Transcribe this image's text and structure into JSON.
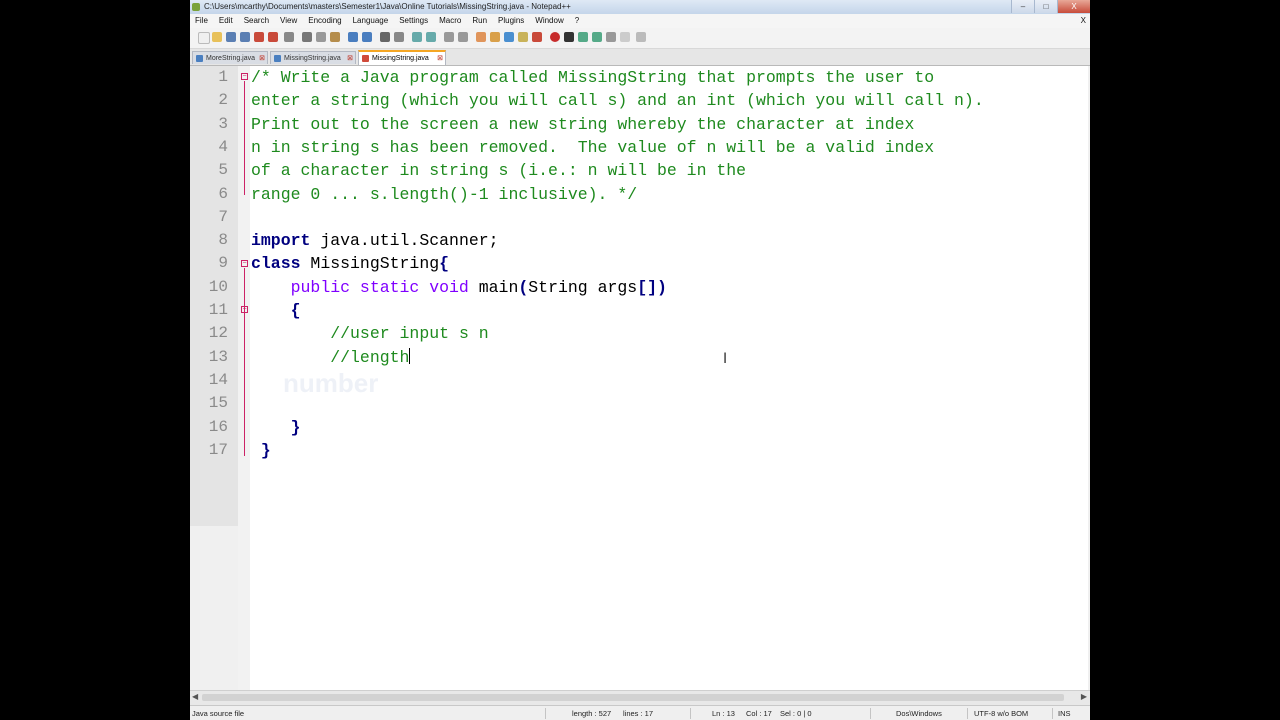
{
  "window": {
    "title": "C:\\Users\\mcarthy\\Documents\\masters\\Semester1\\Java\\Online Tutorials\\MissingString.java - Notepad++",
    "buttons": [
      "–",
      "□",
      "X"
    ]
  },
  "menu": {
    "items": [
      "File",
      "Edit",
      "Search",
      "View",
      "Encoding",
      "Language",
      "Settings",
      "Macro",
      "Run",
      "Plugins",
      "Window",
      "?"
    ],
    "close": "X"
  },
  "tabs": [
    {
      "label": "MoreString.java",
      "active": false
    },
    {
      "label": "MissingString.java",
      "active": false
    },
    {
      "label": "MissingString.java",
      "active": true
    }
  ],
  "editor": {
    "lines": [
      {
        "num": "1",
        "segments": [
          {
            "c": "cmt",
            "t": "/* Write a Java program called MissingString that prompts the user to"
          }
        ]
      },
      {
        "num": "2",
        "segments": [
          {
            "c": "cmt",
            "t": "enter a string (which you will call s) and an int (which you will call n)."
          }
        ]
      },
      {
        "num": "3",
        "segments": [
          {
            "c": "cmt",
            "t": "Print out to the screen a new string whereby the character at index"
          }
        ]
      },
      {
        "num": "4",
        "segments": [
          {
            "c": "cmt",
            "t": "n in string s has been removed.  The value of n will be a valid index"
          }
        ]
      },
      {
        "num": "5",
        "segments": [
          {
            "c": "cmt",
            "t": "of a character in string s (i.e.: n will be in the"
          }
        ]
      },
      {
        "num": "6",
        "segments": [
          {
            "c": "cmt",
            "t": "range 0 ... s.length()-1 inclusive). */"
          }
        ]
      },
      {
        "num": "7",
        "segments": []
      },
      {
        "num": "8",
        "segments": [
          {
            "c": "kw",
            "t": "import"
          },
          {
            "c": "txt",
            "t": " java.util.Scanner;"
          }
        ]
      },
      {
        "num": "9",
        "segments": [
          {
            "c": "kw",
            "t": "class"
          },
          {
            "c": "txt",
            "t": " MissingString"
          },
          {
            "c": "brace",
            "t": "{"
          }
        ]
      },
      {
        "num": "10",
        "segments": [
          {
            "c": "txt",
            "t": "    "
          },
          {
            "c": "type",
            "t": "public static void"
          },
          {
            "c": "txt",
            "t": " main"
          },
          {
            "c": "brace",
            "t": "("
          },
          {
            "c": "txt",
            "t": "String args"
          },
          {
            "c": "brace",
            "t": "[])"
          }
        ]
      },
      {
        "num": "11",
        "segments": [
          {
            "c": "txt",
            "t": "    "
          },
          {
            "c": "brace",
            "t": "{"
          }
        ]
      },
      {
        "num": "12",
        "segments": [
          {
            "c": "txt",
            "t": "        "
          },
          {
            "c": "cmt",
            "t": "//user input s n"
          }
        ]
      },
      {
        "num": "13",
        "segments": [
          {
            "c": "txt",
            "t": "        "
          },
          {
            "c": "cmt",
            "t": "//length"
          }
        ],
        "caret": true
      },
      {
        "num": "14",
        "segments": []
      },
      {
        "num": "15",
        "segments": []
      },
      {
        "num": "16",
        "segments": [
          {
            "c": "txt",
            "t": "    "
          },
          {
            "c": "brace",
            "t": "}"
          }
        ]
      },
      {
        "num": "17",
        "segments": [
          {
            "c": "txt",
            "t": " "
          },
          {
            "c": "brace",
            "t": "}"
          }
        ]
      }
    ],
    "ghost_text": "number"
  },
  "status": {
    "file_type": "Java source file",
    "length": "length : 527",
    "lines": "lines : 17",
    "ln": "Ln : 13",
    "col": "Col : 17",
    "sel": "Sel : 0 | 0",
    "eol": "Dos\\Windows",
    "encoding": "UTF-8 w/o BOM",
    "mode": "INS"
  },
  "colors": {
    "comment": "#1e8a1e",
    "keyword": "#00007f",
    "type": "#8000ff",
    "active_tab_accent": "#f5a623"
  }
}
